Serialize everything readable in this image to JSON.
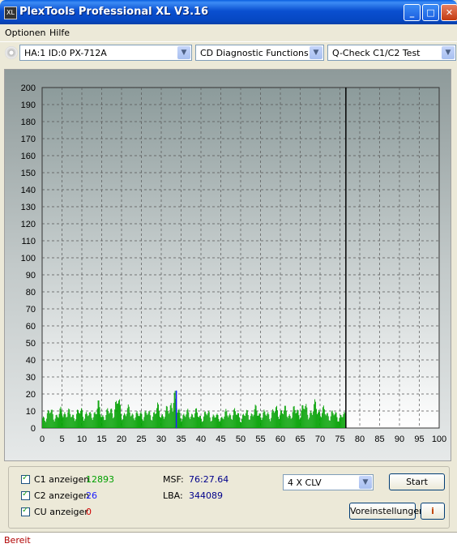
{
  "window": {
    "title": "PlexTools Professional XL V3.16",
    "icon_text": "XL",
    "minimize": "_",
    "maximize": "□",
    "close": "✕"
  },
  "menu": [
    "Optionen",
    "Hilfe"
  ],
  "toolbar": {
    "drive": "HA:1 ID:0  PX-712A",
    "function": "CD Diagnostic Functions",
    "test": "Q-Check C1/C2 Test"
  },
  "chart_data": {
    "type": "bar",
    "xlim": [
      0,
      100
    ],
    "ylim": [
      0,
      200
    ],
    "x_ticks": [
      "0",
      "5",
      "10",
      "15",
      "20",
      "25",
      "30",
      "35",
      "40",
      "45",
      "50",
      "55",
      "60",
      "65",
      "70",
      "75",
      "80",
      "85",
      "90",
      "95",
      "100"
    ],
    "y_ticks": [
      "0",
      "10",
      "20",
      "30",
      "40",
      "50",
      "60",
      "70",
      "80",
      "90",
      "100",
      "110",
      "120",
      "130",
      "140",
      "150",
      "160",
      "170",
      "180",
      "190",
      "200"
    ],
    "end_marker_x": 76.5,
    "series": [
      {
        "name": "C1",
        "color": "#00a000",
        "points": [
          [
            0,
            8
          ],
          [
            2,
            12
          ],
          [
            4,
            9
          ],
          [
            5,
            14
          ],
          [
            7,
            10
          ],
          [
            9,
            11
          ],
          [
            10,
            13
          ],
          [
            12,
            9
          ],
          [
            14,
            16
          ],
          [
            15,
            10
          ],
          [
            17,
            12
          ],
          [
            19,
            20
          ],
          [
            20,
            11
          ],
          [
            22,
            13
          ],
          [
            24,
            9
          ],
          [
            25,
            12
          ],
          [
            27,
            10
          ],
          [
            29,
            14
          ],
          [
            30,
            11
          ],
          [
            32,
            13
          ],
          [
            33,
            30
          ],
          [
            34,
            12
          ],
          [
            36,
            10
          ],
          [
            38,
            12
          ],
          [
            40,
            9
          ],
          [
            42,
            11
          ],
          [
            44,
            8
          ],
          [
            46,
            10
          ],
          [
            48,
            12
          ],
          [
            50,
            9
          ],
          [
            52,
            11
          ],
          [
            54,
            13
          ],
          [
            56,
            10
          ],
          [
            58,
            12
          ],
          [
            60,
            14
          ],
          [
            62,
            11
          ],
          [
            64,
            13
          ],
          [
            66,
            15
          ],
          [
            68,
            12
          ],
          [
            69,
            18
          ],
          [
            70,
            13
          ],
          [
            72,
            11
          ],
          [
            74,
            10
          ],
          [
            76,
            9
          ]
        ]
      },
      {
        "name": "C2",
        "color": "#1a1aff",
        "points": [
          [
            33.8,
            22
          ]
        ]
      }
    ]
  },
  "stats": {
    "c1_label": "C1 anzeigen",
    "c1_value": "12893",
    "c2_label": "C2 anzeigen",
    "c2_value": "26",
    "cu_label": "CU anzeiger",
    "cu_value": "0",
    "msf_label": "MSF:",
    "msf_value": "76:27.64",
    "lba_label": "LBA:",
    "lba_value": "344089"
  },
  "speed": "4 X CLV",
  "buttons": {
    "start": "Start",
    "settings": "Voreinstellungen",
    "info": "i"
  },
  "status": "Bereit",
  "colors": {
    "c1": "#00a000",
    "c2": "#1a1aff",
    "cu": "#d00000",
    "status": "#b00000"
  }
}
